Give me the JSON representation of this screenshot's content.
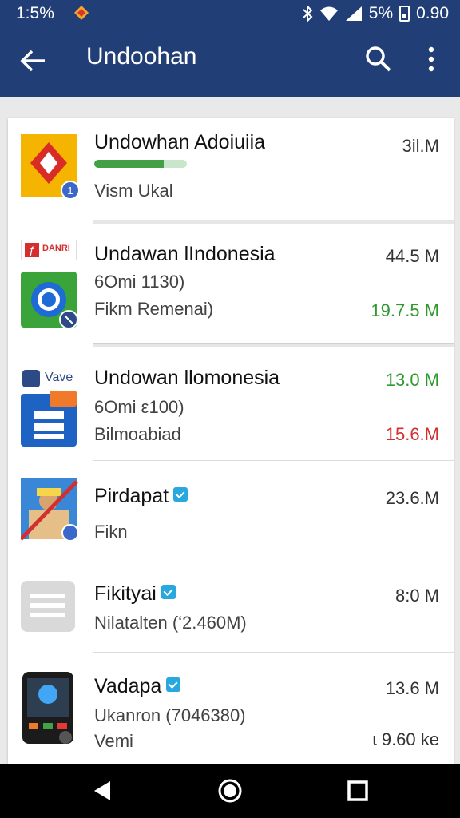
{
  "status_bar": {
    "time": "1:5%",
    "battery": "5%",
    "clock": "0.90"
  },
  "app_bar": {
    "title": "Undoohan"
  },
  "items": [
    {
      "name": "Undowhan Adoiuiia",
      "subtitle": "Vism Ukal",
      "size": "3il.M",
      "progress": 0.75
    },
    {
      "name": "Undawan lIndonesia",
      "line2": "6Omi 1130)",
      "line3": "Fikm Remenai)",
      "size": "44.5 M",
      "size2": "19.7.5 M",
      "badge_text": "DANRI"
    },
    {
      "name": "Undowan llomonesia",
      "line2": "6Omi ε100)",
      "line3": "Bilmoabiad",
      "size": "13.0 M",
      "size2": "15.6.M",
      "badge_text": "Vave"
    },
    {
      "name": "Pirdapat",
      "subtitle": "Fikn",
      "size": "23.6.M"
    },
    {
      "name": "Fikityai",
      "subtitle": "Nilatalten (ʻ2.460M)",
      "size": "8:0 M"
    },
    {
      "name": "Vadapa",
      "line2": "Ukanron (7046380)",
      "line3": "Vemi",
      "size": "13.6 M",
      "size2": "ɩ 9.60 ke"
    }
  ],
  "colors": {
    "appbar": "#213f76",
    "green": "#2e9a2e",
    "red": "#d32f2f",
    "verified": "#29a8e0"
  },
  "icons": [
    "back-arrow-icon",
    "search-icon",
    "more-vert-icon",
    "back-triangle-icon",
    "home-circle-icon",
    "recents-square-icon"
  ]
}
